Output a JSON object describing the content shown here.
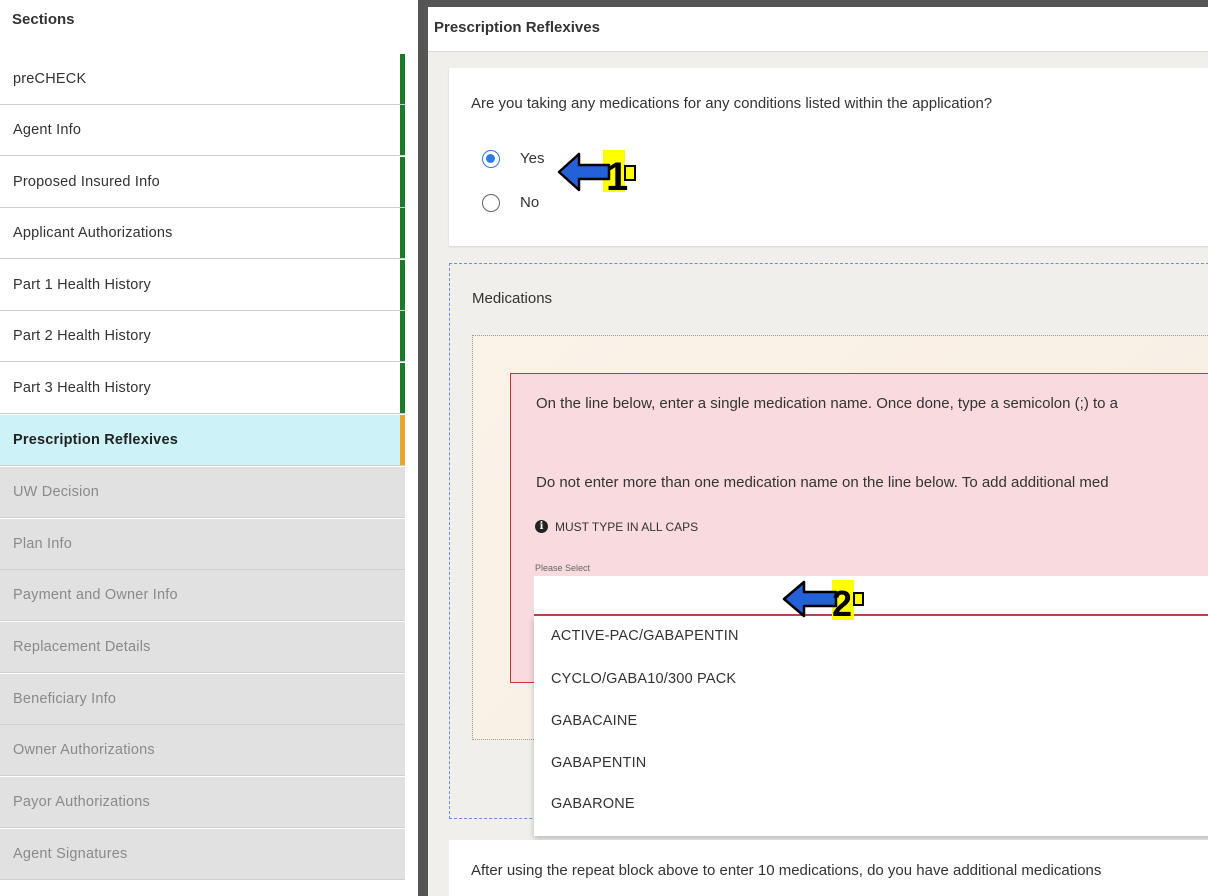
{
  "sidebar": {
    "title": "Sections",
    "items": [
      {
        "label": "preCHECK",
        "state": "done"
      },
      {
        "label": "Agent Info",
        "state": "done"
      },
      {
        "label": "Proposed Insured Info",
        "state": "done"
      },
      {
        "label": "Applicant Authorizations",
        "state": "done"
      },
      {
        "label": "Part 1 Health History",
        "state": "done"
      },
      {
        "label": "Part 2 Health History",
        "state": "done"
      },
      {
        "label": "Part 3 Health History",
        "state": "done"
      },
      {
        "label": "Prescription Reflexives",
        "state": "active"
      },
      {
        "label": "UW Decision",
        "state": "todo"
      },
      {
        "label": "Plan Info",
        "state": "todo"
      },
      {
        "label": "Payment and Owner Info",
        "state": "todo"
      },
      {
        "label": "Replacement Details",
        "state": "todo"
      },
      {
        "label": "Beneficiary Info",
        "state": "todo"
      },
      {
        "label": "Owner Authorizations",
        "state": "todo"
      },
      {
        "label": "Payor Authorizations",
        "state": "todo"
      },
      {
        "label": "Agent Signatures",
        "state": "todo"
      }
    ]
  },
  "main": {
    "title": "Prescription Reflexives",
    "question": "Are you taking any medications for any conditions listed within the application?",
    "options": [
      {
        "label": "Yes",
        "checked": true
      },
      {
        "label": "No",
        "checked": false
      }
    ],
    "medications": {
      "title": "Medications",
      "instruction1": "On the line below, enter a single medication name.  Once done, type a semicolon (;) to a",
      "instruction2": "Do not enter more than one medication name on the line below.  To add additional med",
      "caps_note": "MUST TYPE IN ALL CAPS",
      "select_label": "Please Select",
      "select_value": "",
      "dropdown": [
        "ACTIVE-PAC/GABAPENTIN",
        "CYCLO/GABA10/300 PACK",
        "GABACAINE",
        "GABAPENTIN",
        "GABARONE"
      ]
    },
    "followup_question": "After using the repeat block above to enter 10 medications, do you have additional medications"
  },
  "annotations": [
    {
      "number": "1",
      "color": "#2460d8",
      "badge_color": "#ffff00"
    },
    {
      "number": "2",
      "color": "#2460d8",
      "badge_color": "#ffff00"
    }
  ]
}
